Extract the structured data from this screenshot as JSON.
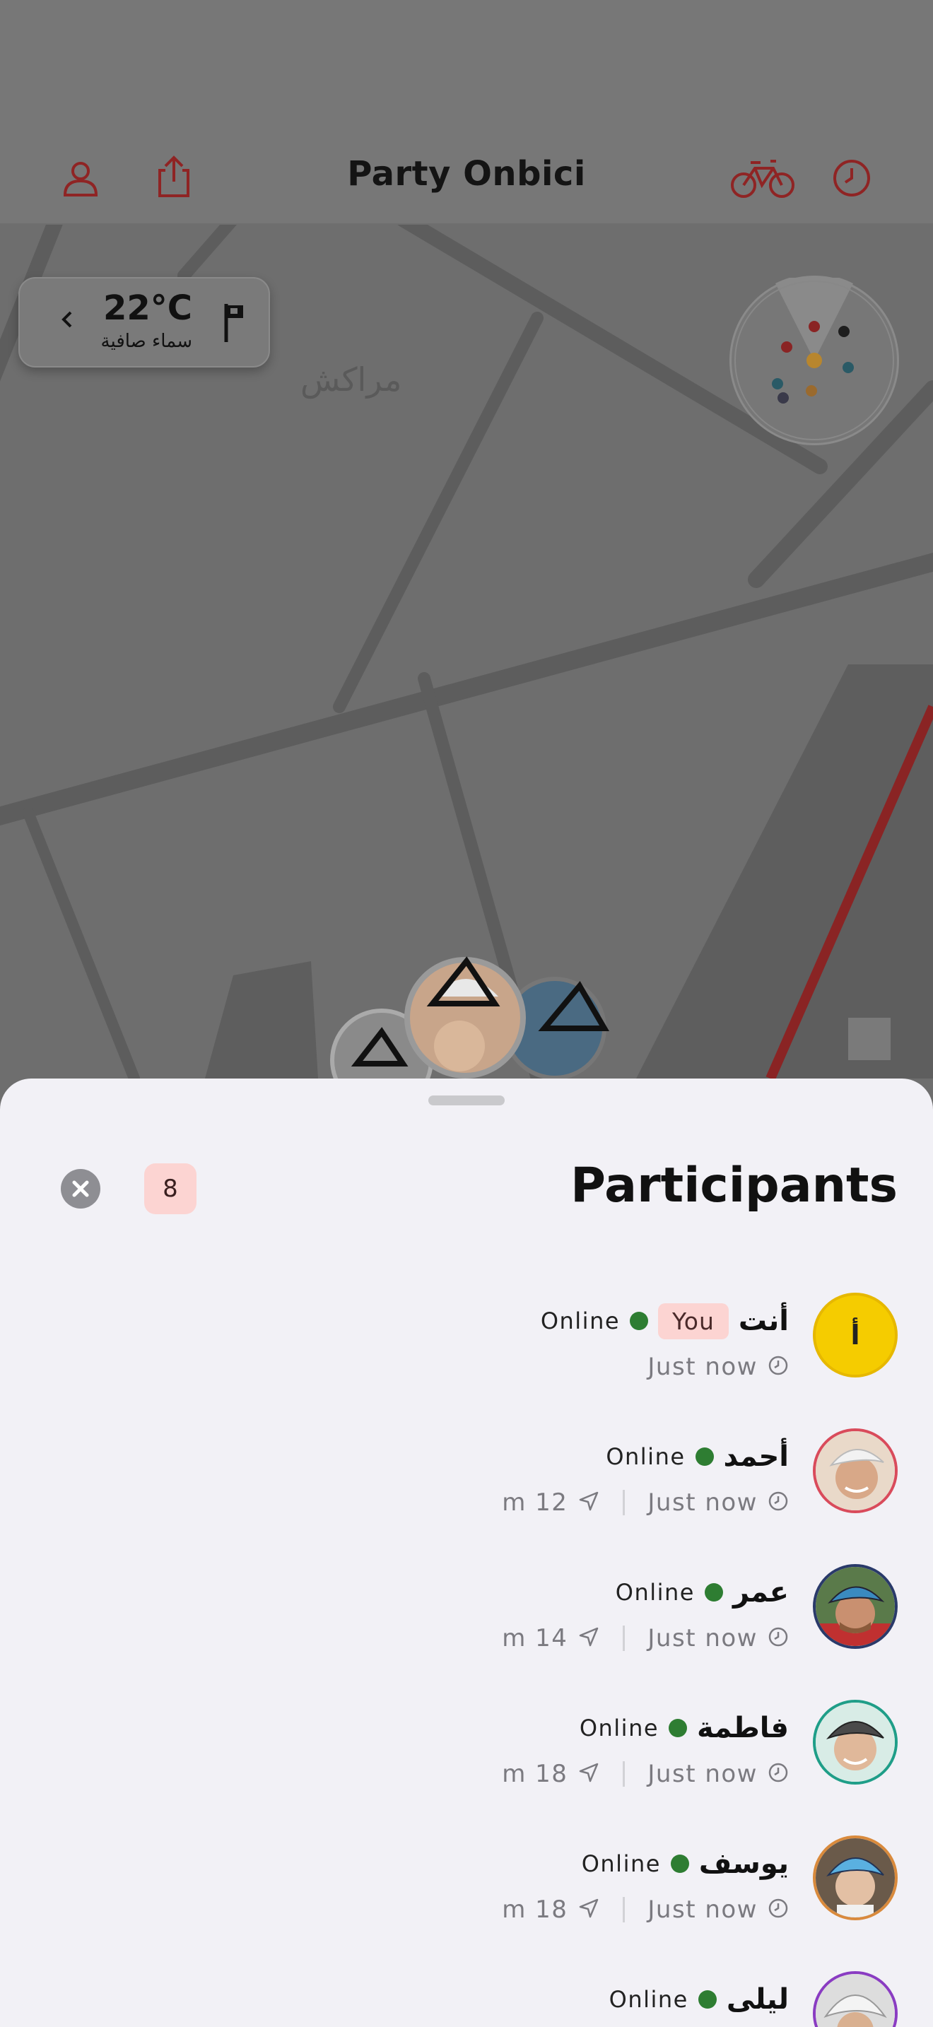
{
  "header": {
    "title": "Party Onbici",
    "icons": [
      "person-icon",
      "share-icon",
      "bicycle-icon",
      "clock-icon"
    ]
  },
  "weather": {
    "temperature": "22°C",
    "description": "سماء صافية",
    "icons": [
      "chevron-left-icon",
      "flag-icon"
    ]
  },
  "map": {
    "city_label": "مراكش"
  },
  "sheet": {
    "title": "Participants",
    "count": "8",
    "participants": [
      {
        "name": "أنت",
        "initial": "أ",
        "is_you": true,
        "you_label": "You",
        "status": "Online",
        "last_seen": "Just now",
        "distance": "",
        "ring_color": "#e6b800"
      },
      {
        "name": "أحمد",
        "status": "Online",
        "last_seen": "Just now",
        "distance": "m 12",
        "ring_color": "#d94b5b"
      },
      {
        "name": "عمر",
        "status": "Online",
        "last_seen": "Just now",
        "distance": "m 14",
        "ring_color": "#2a3a6a"
      },
      {
        "name": "فاطمة",
        "status": "Online",
        "last_seen": "Just now",
        "distance": "m 18",
        "ring_color": "#1f9e88"
      },
      {
        "name": "يوسف",
        "status": "Online",
        "last_seen": "Just now",
        "distance": "m 18",
        "ring_color": "#d98a3c"
      },
      {
        "name": "ليلى",
        "status": "Online",
        "last_seen": "",
        "distance": "",
        "ring_color": "#8a3cc2"
      }
    ]
  },
  "colors": {
    "accent": "#b02a2a",
    "online": "#2e7d32",
    "badge_bg": "#fcd4d2",
    "sheet_bg": "#f2f1f6"
  }
}
